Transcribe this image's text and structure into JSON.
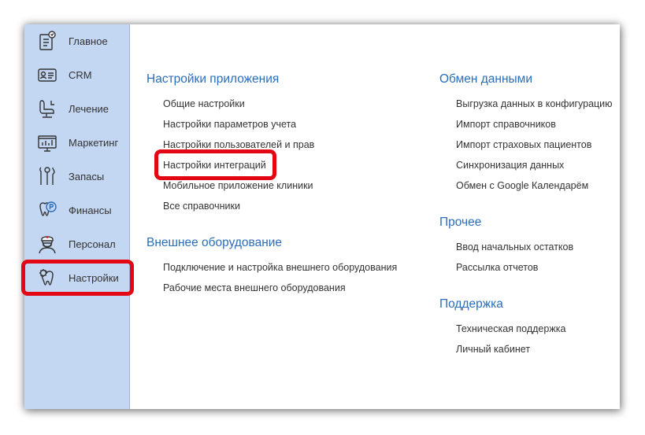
{
  "sidebar": {
    "items": [
      {
        "label": "Главное",
        "icon": "home-icon"
      },
      {
        "label": "CRM",
        "icon": "contact-card-icon"
      },
      {
        "label": "Лечение",
        "icon": "dental-chair-icon"
      },
      {
        "label": "Маркетинг",
        "icon": "presentation-board-icon"
      },
      {
        "label": "Запасы",
        "icon": "dental-tools-icon"
      },
      {
        "label": "Финансы",
        "icon": "tooth-coin-icon"
      },
      {
        "label": "Персонал",
        "icon": "doctor-icon"
      },
      {
        "label": "Настройки",
        "icon": "tooth-gear-icon"
      }
    ]
  },
  "sections": {
    "app_settings": {
      "title": "Настройки приложения",
      "links": [
        "Общие настройки",
        "Настройки параметров учета",
        "Настройки пользователей и прав",
        "Настройки интеграций",
        "Мобильное приложение клиники",
        "Все справочники"
      ]
    },
    "external_equipment": {
      "title": "Внешнее оборудование",
      "links": [
        "Подключение и настройка внешнего оборудования",
        "Рабочие места внешнего оборудования"
      ]
    },
    "data_exchange": {
      "title": "Обмен данными",
      "links": [
        "Выгрузка данных в конфигурацию",
        "Импорт справочников",
        "Импорт страховых пациентов",
        "Синхронизация данных",
        "Обмен с Google Календарём"
      ]
    },
    "other": {
      "title": "Прочее",
      "links": [
        "Ввод начальных остатков",
        "Рассылка отчетов"
      ]
    },
    "support": {
      "title": "Поддержка",
      "links": [
        "Техническая поддержка",
        "Личный кабинет"
      ]
    }
  },
  "colors": {
    "sidebar_bg": "#c3d6f2",
    "section_title": "#2a6ebb",
    "link_text": "#333333",
    "highlight": "#e30613"
  }
}
